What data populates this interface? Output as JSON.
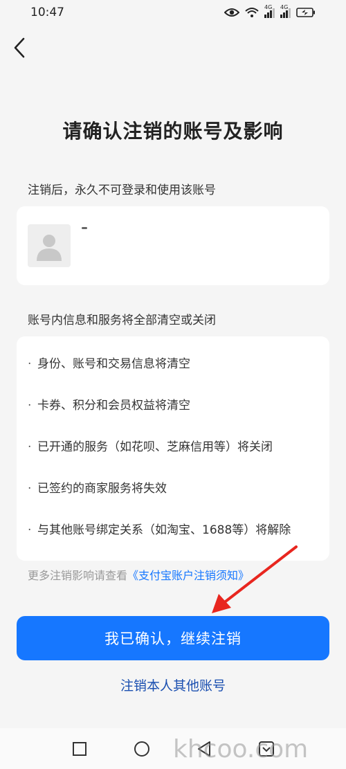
{
  "status_bar": {
    "time": "10:47",
    "network_1": "4G",
    "network_2": "4G"
  },
  "header": {
    "title": "请确认注销的账号及影响"
  },
  "account_section": {
    "label": "注销后，永久不可登录和使用该账号"
  },
  "info_section": {
    "label": "账号内信息和服务将全部清空或关闭",
    "bullet": "·",
    "items": [
      "身份、账号和交易信息将清空",
      "卡券、积分和会员权益将清空",
      "已开通的服务（如花呗、芝麻信用等）将关闭",
      "已签约的商家服务将失效",
      "与其他账号绑定关系（如淘宝、1688等）将解除"
    ]
  },
  "more": {
    "prefix": "更多注销影响请查看",
    "link": "《支付宝账户注销须知》"
  },
  "actions": {
    "confirm": "我已确认，继续注销",
    "other": "注销本人其他账号"
  },
  "watermark": "khcoo.com",
  "colors": {
    "primary": "#1677ff",
    "link": "#1a4fb0",
    "arrow": "#e8261f",
    "background": "#f5f5f5"
  },
  "icons": [
    "back-icon",
    "eye-icon",
    "wifi-icon",
    "signal-icon",
    "battery-icon",
    "avatar-icon",
    "nav-recents-icon",
    "nav-home-icon",
    "nav-back-icon",
    "nav-down-icon"
  ]
}
